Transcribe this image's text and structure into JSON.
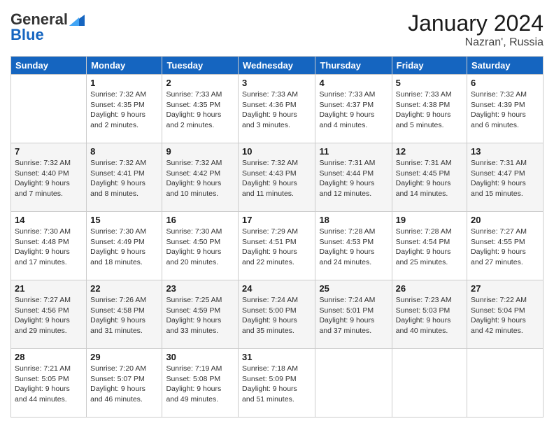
{
  "header": {
    "logo_general": "General",
    "logo_blue": "Blue",
    "month_title": "January 2024",
    "location": "Nazran', Russia"
  },
  "weekdays": [
    "Sunday",
    "Monday",
    "Tuesday",
    "Wednesday",
    "Thursday",
    "Friday",
    "Saturday"
  ],
  "weeks": [
    [
      {
        "day": "",
        "info": ""
      },
      {
        "day": "1",
        "info": "Sunrise: 7:32 AM\nSunset: 4:35 PM\nDaylight: 9 hours\nand 2 minutes."
      },
      {
        "day": "2",
        "info": "Sunrise: 7:33 AM\nSunset: 4:35 PM\nDaylight: 9 hours\nand 2 minutes."
      },
      {
        "day": "3",
        "info": "Sunrise: 7:33 AM\nSunset: 4:36 PM\nDaylight: 9 hours\nand 3 minutes."
      },
      {
        "day": "4",
        "info": "Sunrise: 7:33 AM\nSunset: 4:37 PM\nDaylight: 9 hours\nand 4 minutes."
      },
      {
        "day": "5",
        "info": "Sunrise: 7:33 AM\nSunset: 4:38 PM\nDaylight: 9 hours\nand 5 minutes."
      },
      {
        "day": "6",
        "info": "Sunrise: 7:32 AM\nSunset: 4:39 PM\nDaylight: 9 hours\nand 6 minutes."
      }
    ],
    [
      {
        "day": "7",
        "info": "Sunrise: 7:32 AM\nSunset: 4:40 PM\nDaylight: 9 hours\nand 7 minutes."
      },
      {
        "day": "8",
        "info": "Sunrise: 7:32 AM\nSunset: 4:41 PM\nDaylight: 9 hours\nand 8 minutes."
      },
      {
        "day": "9",
        "info": "Sunrise: 7:32 AM\nSunset: 4:42 PM\nDaylight: 9 hours\nand 10 minutes."
      },
      {
        "day": "10",
        "info": "Sunrise: 7:32 AM\nSunset: 4:43 PM\nDaylight: 9 hours\nand 11 minutes."
      },
      {
        "day": "11",
        "info": "Sunrise: 7:31 AM\nSunset: 4:44 PM\nDaylight: 9 hours\nand 12 minutes."
      },
      {
        "day": "12",
        "info": "Sunrise: 7:31 AM\nSunset: 4:45 PM\nDaylight: 9 hours\nand 14 minutes."
      },
      {
        "day": "13",
        "info": "Sunrise: 7:31 AM\nSunset: 4:47 PM\nDaylight: 9 hours\nand 15 minutes."
      }
    ],
    [
      {
        "day": "14",
        "info": "Sunrise: 7:30 AM\nSunset: 4:48 PM\nDaylight: 9 hours\nand 17 minutes."
      },
      {
        "day": "15",
        "info": "Sunrise: 7:30 AM\nSunset: 4:49 PM\nDaylight: 9 hours\nand 18 minutes."
      },
      {
        "day": "16",
        "info": "Sunrise: 7:30 AM\nSunset: 4:50 PM\nDaylight: 9 hours\nand 20 minutes."
      },
      {
        "day": "17",
        "info": "Sunrise: 7:29 AM\nSunset: 4:51 PM\nDaylight: 9 hours\nand 22 minutes."
      },
      {
        "day": "18",
        "info": "Sunrise: 7:28 AM\nSunset: 4:53 PM\nDaylight: 9 hours\nand 24 minutes."
      },
      {
        "day": "19",
        "info": "Sunrise: 7:28 AM\nSunset: 4:54 PM\nDaylight: 9 hours\nand 25 minutes."
      },
      {
        "day": "20",
        "info": "Sunrise: 7:27 AM\nSunset: 4:55 PM\nDaylight: 9 hours\nand 27 minutes."
      }
    ],
    [
      {
        "day": "21",
        "info": "Sunrise: 7:27 AM\nSunset: 4:56 PM\nDaylight: 9 hours\nand 29 minutes."
      },
      {
        "day": "22",
        "info": "Sunrise: 7:26 AM\nSunset: 4:58 PM\nDaylight: 9 hours\nand 31 minutes."
      },
      {
        "day": "23",
        "info": "Sunrise: 7:25 AM\nSunset: 4:59 PM\nDaylight: 9 hours\nand 33 minutes."
      },
      {
        "day": "24",
        "info": "Sunrise: 7:24 AM\nSunset: 5:00 PM\nDaylight: 9 hours\nand 35 minutes."
      },
      {
        "day": "25",
        "info": "Sunrise: 7:24 AM\nSunset: 5:01 PM\nDaylight: 9 hours\nand 37 minutes."
      },
      {
        "day": "26",
        "info": "Sunrise: 7:23 AM\nSunset: 5:03 PM\nDaylight: 9 hours\nand 40 minutes."
      },
      {
        "day": "27",
        "info": "Sunrise: 7:22 AM\nSunset: 5:04 PM\nDaylight: 9 hours\nand 42 minutes."
      }
    ],
    [
      {
        "day": "28",
        "info": "Sunrise: 7:21 AM\nSunset: 5:05 PM\nDaylight: 9 hours\nand 44 minutes."
      },
      {
        "day": "29",
        "info": "Sunrise: 7:20 AM\nSunset: 5:07 PM\nDaylight: 9 hours\nand 46 minutes."
      },
      {
        "day": "30",
        "info": "Sunrise: 7:19 AM\nSunset: 5:08 PM\nDaylight: 9 hours\nand 49 minutes."
      },
      {
        "day": "31",
        "info": "Sunrise: 7:18 AM\nSunset: 5:09 PM\nDaylight: 9 hours\nand 51 minutes."
      },
      {
        "day": "",
        "info": ""
      },
      {
        "day": "",
        "info": ""
      },
      {
        "day": "",
        "info": ""
      }
    ]
  ]
}
